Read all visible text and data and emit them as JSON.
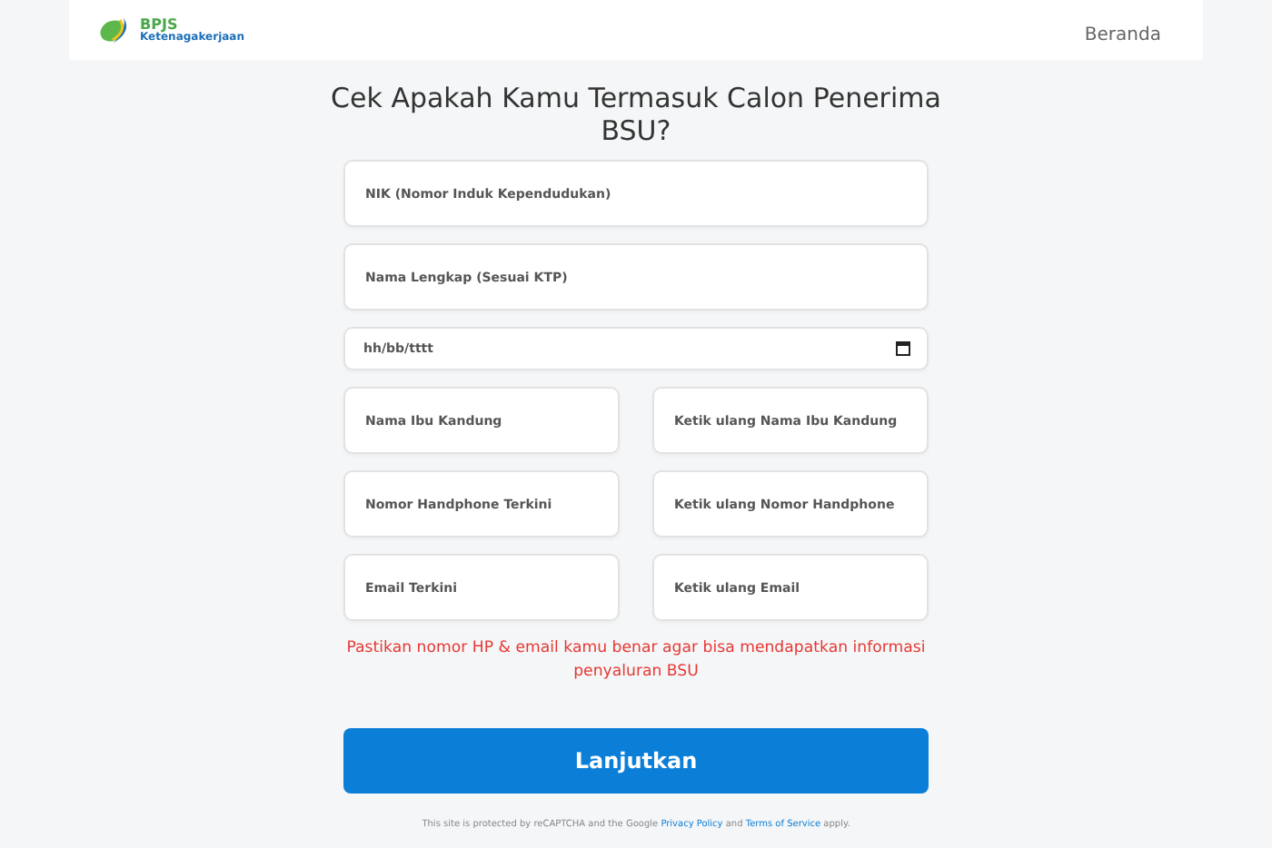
{
  "header": {
    "logo_title": "BPJS",
    "logo_subtitle": "Ketenagakerjaan",
    "nav": [
      {
        "label": "Beranda"
      }
    ]
  },
  "form": {
    "title": "Cek Apakah Kamu Termasuk Calon Penerima BSU?",
    "rows": [
      {
        "fields": [
          {
            "kind": "text",
            "placeholder": "NIK (Nomor Induk Kependudukan)"
          }
        ]
      },
      {
        "fields": [
          {
            "kind": "text",
            "placeholder": "Nama Lengkap (Sesuai KTP)"
          }
        ]
      },
      {
        "fields": [
          {
            "kind": "date",
            "placeholder": "hh/bb/tttt"
          }
        ]
      },
      {
        "fields": [
          {
            "kind": "text",
            "placeholder": "Nama Ibu Kandung"
          },
          {
            "kind": "text",
            "placeholder": "Ketik ulang Nama Ibu Kandung"
          }
        ]
      },
      {
        "fields": [
          {
            "kind": "text",
            "placeholder": "Nomor Handphone Terkini"
          },
          {
            "kind": "text",
            "placeholder": "Ketik ulang Nomor Handphone"
          }
        ]
      },
      {
        "fields": [
          {
            "kind": "text",
            "placeholder": "Email Terkini"
          },
          {
            "kind": "text",
            "placeholder": "Ketik ulang Email"
          }
        ]
      }
    ],
    "warning": "Pastikan nomor HP & email kamu benar agar bisa mendapatkan informasi penyaluran BSU",
    "submit": "Lanjutkan",
    "footer": [
      {
        "kind": "text",
        "text": "This site is protected by reCAPTCHA and the Google "
      },
      {
        "kind": "link",
        "text": "Privacy Policy"
      },
      {
        "kind": "text",
        "text": " and "
      },
      {
        "kind": "link",
        "text": "Terms of Service"
      },
      {
        "kind": "text",
        "text": " apply."
      }
    ]
  }
}
